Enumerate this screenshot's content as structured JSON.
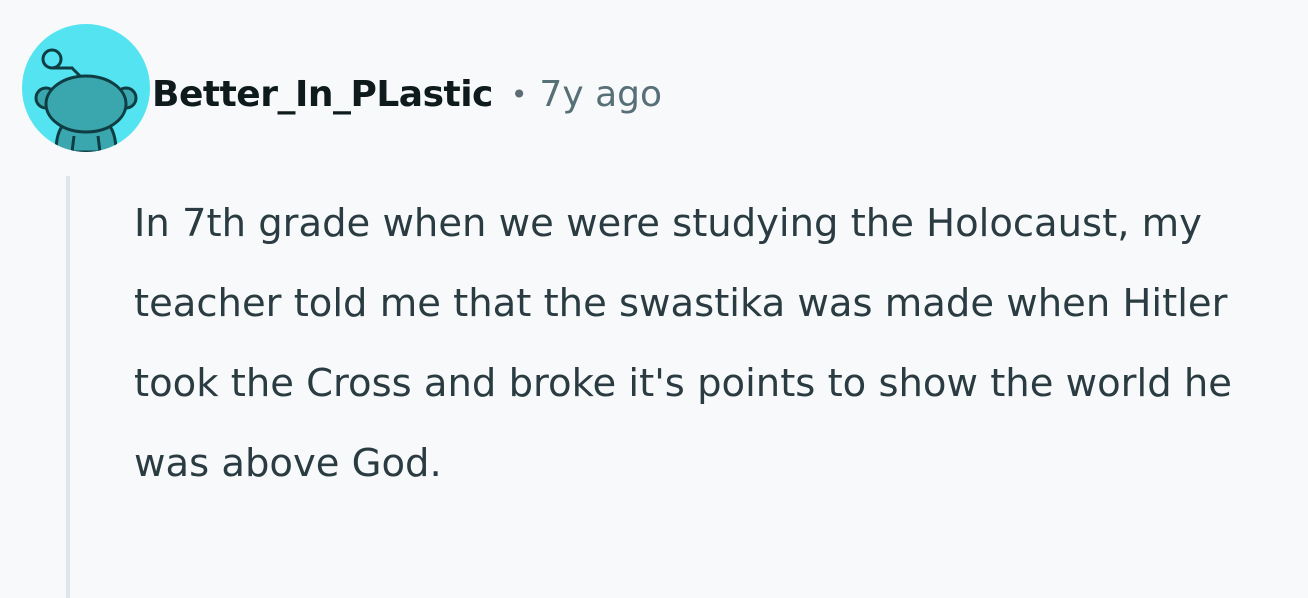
{
  "comment": {
    "author": "Better_In_PLastic",
    "separator": "•",
    "timestamp": "7y ago",
    "avatar_icon": "snoo-avatar-icon",
    "avatar_color": "#54e3f0",
    "body": "In 7th grade when we were studying the Holocaust, my teacher told me that the swastika was made when Hitler took the Cross and broke it's points to show the world he was above God."
  }
}
